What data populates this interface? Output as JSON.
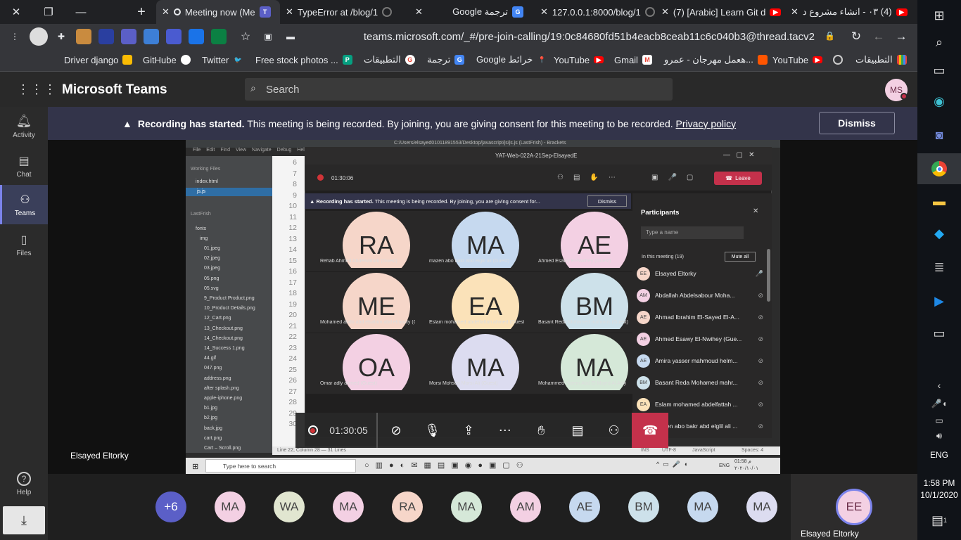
{
  "tabs": [
    {
      "title": "Meeting now (Me",
      "active": true,
      "icon": "teams-icon"
    },
    {
      "title": "TypeError at /blog/1",
      "active": false,
      "icon": "django-icon"
    },
    {
      "title": "Google ترجمة",
      "active": false,
      "icon": "translate-icon"
    },
    {
      "title": "127.0.0.1:8000/blog/1",
      "active": false,
      "icon": "globe-icon"
    },
    {
      "title": "(7) [Arabic] Learn Git d",
      "active": false,
      "icon": "youtube-icon"
    },
    {
      "title": "(4) ٠٣ - انشاء مشروع د",
      "active": false,
      "icon": "youtube-icon"
    }
  ],
  "url": "teams.microsoft.com/_#/pre-join-calling/19:0c84680fd51b4eacb8ceab11c6c040b3@thread.tacv2",
  "bookmarks": [
    {
      "label": "Driver django",
      "icon": "drive-icon",
      "color": "#fbbc04"
    },
    {
      "label": "GitHube",
      "icon": "github-icon",
      "color": "#ffffff"
    },
    {
      "label": "Twitter",
      "icon": "twitter-icon",
      "color": "#1da1f2"
    },
    {
      "label": "Free stock photos ...",
      "icon": "pexels-icon",
      "color": "#05a081"
    },
    {
      "label": "التطبيقات",
      "icon": "google-icon",
      "color": "#ea4335"
    },
    {
      "label": "ترجمة",
      "icon": "translate-icon",
      "color": "#4285f4"
    },
    {
      "label": "Google خرائط",
      "icon": "maps-icon",
      "color": "#34a853"
    },
    {
      "label": "YouTube",
      "icon": "youtube-icon",
      "color": "#ff0000"
    },
    {
      "label": "Gmail",
      "icon": "gmail-icon",
      "color": "#ea4335"
    },
    {
      "label": "هعمل مهرجان - عمرو...",
      "icon": "soundcloud-icon",
      "color": "#ff5500"
    },
    {
      "label": "YouTube",
      "icon": "youtube-icon",
      "color": "#ff0000"
    },
    {
      "label": "",
      "icon": "globe-icon",
      "color": "#aaaaaa"
    },
    {
      "label": "التطبيقات",
      "icon": "apps-grid-icon",
      "color": "#e8eaed"
    }
  ],
  "teams": {
    "app_title": "Microsoft Teams",
    "search_placeholder": "Search",
    "user_initials": "MS",
    "rail": [
      {
        "label": "Activity",
        "icon": "bell-icon"
      },
      {
        "label": "Chat",
        "icon": "chat-icon"
      },
      {
        "label": "Teams",
        "icon": "teams-icon"
      },
      {
        "label": "Files",
        "icon": "file-icon"
      }
    ],
    "help_label": "Help",
    "banner": {
      "bold": "Recording has started.",
      "text": " This meeting is being recorded. By joining, you are giving consent for this meeting to be recorded. ",
      "link": "Privacy policy",
      "dismiss": "Dismiss"
    },
    "presenter_name": "Elsayed Eltorky",
    "self_name": "Elsayed Eltorky",
    "self_initials": "EE"
  },
  "shared": {
    "editor_path": "C:/Users/elsayed01011891553/Desktop/javascript/js/js.js (LastFrish) - Brackets",
    "menu": [
      "File",
      "Edit",
      "Find",
      "View",
      "Navigate",
      "Debug",
      "Help"
    ],
    "working_files_label": "Working Files",
    "working_files": [
      "index.html",
      "js.js"
    ],
    "project_label": "LastFrish",
    "folders": [
      "fonts",
      "img"
    ],
    "files": [
      "01.jpeg",
      "02.jpeg",
      "03.jpeg",
      "05.png",
      "05.svg",
      "9_Product Product.png",
      "10_Product Details.png",
      "12_Cart.png",
      "13_Checkout.png",
      "14_Checkout.png",
      "14_Success 1.png",
      "44.gif",
      "047.png",
      "address.png",
      "after splash.png",
      "apple-iphone.png",
      "b1.jpg",
      "b2.jpg",
      "back.jpg",
      "cart.png",
      "Cart – Scroll.png"
    ],
    "line_numbers": [
      "6",
      "7",
      "8",
      "9",
      "10",
      "11",
      "12",
      "13",
      "14",
      "15",
      "16",
      "17",
      "18",
      "19",
      "20",
      "21",
      "22",
      "23",
      "24",
      "25",
      "26",
      "27",
      "28",
      "29",
      "30"
    ],
    "status_left": "Line 22, Column 28 — 31 Lines",
    "status_right": [
      "INS",
      "UTF-8",
      "JavaScript",
      "Spaces: 4"
    ],
    "inner_meeting_title": "YAT-Web-022A-21Sep-ElsayedE",
    "inner_timer": "01:30:06",
    "inner_leave": "Leave",
    "inner_banner_bold": "Recording has started.",
    "inner_banner_text": "This meeting is being recorded. By joining, you are giving consent for...",
    "inner_dismiss": "Dismiss",
    "grid": [
      {
        "initials": "RA",
        "name": "Rehab Ahmed Abdelwahab (Guest)",
        "color": "#f6d6c9"
      },
      {
        "initials": "MA",
        "name": "mazen abo bakr abd elglil ali (Guest)",
        "color": "#c6d9ef"
      },
      {
        "initials": "AE",
        "name": "Ahmed Esawy El-Nwihey (Guest)",
        "color": "#f3d0e3"
      },
      {
        "initials": "ME",
        "name": "Mohamed abdo abd elsalam abd elmouty (Guest)",
        "color": "#f6d6c9"
      },
      {
        "initials": "EA",
        "name": "Eslam mohamed abdelfattah ahmed (Guest)",
        "color": "#fbe2b9"
      },
      {
        "initials": "BM",
        "name": "Basant Reda Mohamed mahrous (Guest)",
        "color": "#cde1ea"
      },
      {
        "initials": "OA",
        "name": "Omar adly ahmed (Guest)",
        "color": "#f3d0e3"
      },
      {
        "initials": "MA",
        "name": "Morsi Mohsen Morsi Ali (Guest)",
        "color": "#dcdcf0"
      },
      {
        "initials": "MA",
        "name": "Mohammed Hatem Abd El Majed Al Asly",
        "color": "#d5e8d8"
      }
    ],
    "participants_title": "Participants",
    "participants_search": "Type a name",
    "in_meeting": "In this meeting (19)",
    "mute_all": "Mute all",
    "participants": [
      {
        "initials": "EE",
        "name": "Elsayed Eltorky",
        "color": "#f6d6c9"
      },
      {
        "initials": "AM",
        "name": "Abdallah Abdelsabour Moha...",
        "color": "#f3d0e3"
      },
      {
        "initials": "AE",
        "name": "Ahmad Ibrahim El-Sayed El-A...",
        "color": "#f6d6c9"
      },
      {
        "initials": "AE",
        "name": "Ahmed Esawy El-Nwihey (Gue...",
        "color": "#f3d0e3"
      },
      {
        "initials": "AE",
        "name": "Amira yasser mahmoud helm...",
        "color": "#c6d9ef"
      },
      {
        "initials": "BM",
        "name": "Basant Reda Mohamed mahr...",
        "color": "#cde1ea"
      },
      {
        "initials": "EA",
        "name": "Eslam mohamed abdelfattah ...",
        "color": "#fbe2b9"
      },
      {
        "initials": "MA",
        "name": "mazen abo bakr abd elglil ali ...",
        "color": "#c6d9ef"
      }
    ],
    "taskbar_search": "Type here to search",
    "taskbar_time": "01:58 م",
    "taskbar_date": "٢٠٢٠/١٠/٠١",
    "taskbar_lang": "ENG"
  },
  "callbar": {
    "timer": "01:30:05",
    "buttons": [
      "camera-off-icon",
      "mic-off-icon",
      "share-screen-icon",
      "more-icon",
      "raise-hand-icon",
      "chat-icon",
      "participants-icon",
      "hangup-icon"
    ]
  },
  "gallery": [
    {
      "initials": "+6",
      "color": "#5b5fc7"
    },
    {
      "initials": "MA",
      "color": "#f3d0e3"
    },
    {
      "initials": "WA",
      "color": "#e1e6d0"
    },
    {
      "initials": "MA",
      "color": "#f3d0e3"
    },
    {
      "initials": "RA",
      "color": "#f6d6c9"
    },
    {
      "initials": "MA",
      "color": "#d5e8d8"
    },
    {
      "initials": "AM",
      "color": "#f3d0e3"
    },
    {
      "initials": "AE",
      "color": "#c6d9ef"
    },
    {
      "initials": "BM",
      "color": "#cde1ea"
    },
    {
      "initials": "MA",
      "color": "#c6d9ef"
    },
    {
      "initials": "MA",
      "color": "#dcdcf0"
    }
  ],
  "win": {
    "time": "1:58 PM",
    "date": "10/1/2020",
    "lang": "ENG",
    "notif_count": "1"
  }
}
